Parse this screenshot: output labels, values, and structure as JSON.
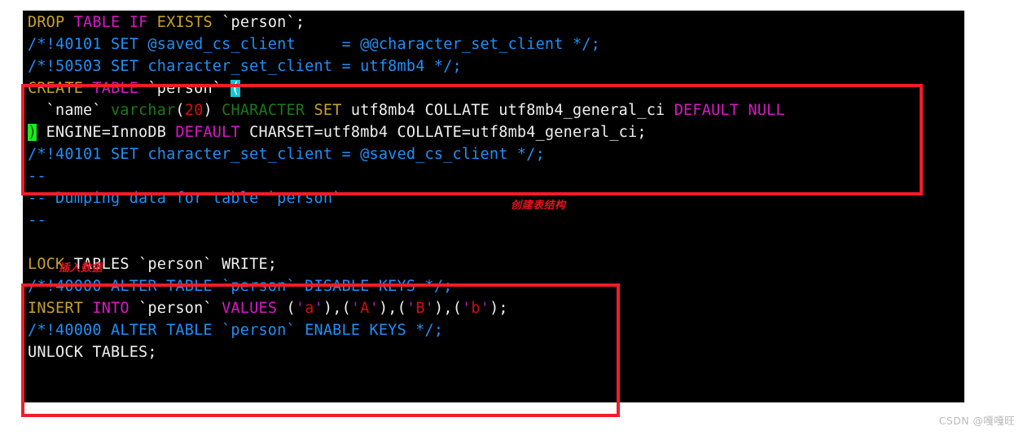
{
  "editor": {
    "background_color": "#000000",
    "default_text_color": "#e8e8e8",
    "lines": [
      {
        "id": "l1",
        "text": "DROP TABLE IF EXISTS `person`;"
      },
      {
        "id": "l2",
        "text": "/*!40101 SET @saved_cs_client     = @@character_set_client */;"
      },
      {
        "id": "l3",
        "text": "/*!50503 SET character_set_client = utf8mb4 */;"
      },
      {
        "id": "l4",
        "text": "CREATE TABLE `person` ("
      },
      {
        "id": "l5",
        "text": "  `name` varchar(20) CHARACTER SET utf8mb4 COLLATE utf8mb4_general_ci DEFAULT NULL"
      },
      {
        "id": "l6",
        "text": ") ENGINE=InnoDB DEFAULT CHARSET=utf8mb4 COLLATE=utf8mb4_general_ci;"
      },
      {
        "id": "l7",
        "text": "/*!40101 SET character_set_client = @saved_cs_client */;"
      },
      {
        "id": "l8",
        "text": "--"
      },
      {
        "id": "l9",
        "text": "-- Dumping data for table `person`"
      },
      {
        "id": "l10",
        "text": "--"
      },
      {
        "id": "l11",
        "text": ""
      },
      {
        "id": "l12",
        "text": "LOCK TABLES `person` WRITE;"
      },
      {
        "id": "l13",
        "text": "/*!40000 ALTER TABLE `person` DISABLE KEYS */;"
      },
      {
        "id": "l14",
        "text": "INSERT INTO `person` VALUES ('a'),('A'),('B'),('b');"
      },
      {
        "id": "l15",
        "text": "/*!40000 ALTER TABLE `person` ENABLE KEYS */;"
      },
      {
        "id": "l16",
        "text": "UNLOCK TABLES;"
      }
    ],
    "tokens": {
      "l1": [
        [
          "DROP",
          "kw-yellow"
        ],
        [
          " ",
          "white"
        ],
        [
          "TABLE",
          "kw-mag"
        ],
        [
          " ",
          "white"
        ],
        [
          "IF",
          "kw-mag"
        ],
        [
          " ",
          "white"
        ],
        [
          "EXISTS",
          "kw-yellow"
        ],
        [
          " `person`;",
          "white"
        ]
      ],
      "l2": [
        [
          "/*!40101 SET @saved_cs_client     = @@character_set_client */;",
          "comment"
        ]
      ],
      "l3": [
        [
          "/*!50503 SET character_set_client = utf8mb4 */;",
          "comment"
        ]
      ],
      "l4": [
        [
          "CREATE",
          "kw-yellow"
        ],
        [
          " ",
          "white"
        ],
        [
          "TABLE",
          "kw-mag"
        ],
        [
          " `person` ",
          "white"
        ],
        [
          "(",
          "hl-open"
        ]
      ],
      "l5": [
        [
          "  `name` ",
          "white"
        ],
        [
          "varchar",
          "green"
        ],
        [
          "(",
          "paren"
        ],
        [
          "20",
          "num"
        ],
        [
          ")",
          "paren"
        ],
        [
          " ",
          "white"
        ],
        [
          "CHARACTER",
          "green"
        ],
        [
          " ",
          "white"
        ],
        [
          "SET",
          "kw-yellow"
        ],
        [
          " utf8mb4 COLLATE utf8mb4_general_ci ",
          "white"
        ],
        [
          "DEFAULT",
          "kw-mag"
        ],
        [
          " ",
          "white"
        ],
        [
          "NULL",
          "kw-mag"
        ]
      ],
      "l6": [
        [
          ")",
          "hl-close"
        ],
        [
          " ENGINE=InnoDB ",
          "white"
        ],
        [
          "DEFAULT",
          "kw-mag"
        ],
        [
          " CHARSET=utf8mb4 COLLATE=utf8mb4_general_ci;",
          "white"
        ]
      ],
      "l7": [
        [
          "/*!40101 SET character_set_client = @saved_cs_client */;",
          "comment"
        ]
      ],
      "l8": [
        [
          "--",
          "comment"
        ]
      ],
      "l9": [
        [
          "-- Dumping data for table `person`",
          "comment"
        ]
      ],
      "l10": [
        [
          "--",
          "comment"
        ]
      ],
      "l11": [
        [
          "",
          "white"
        ]
      ],
      "l12": [
        [
          "LOCK",
          "kw-yellow"
        ],
        [
          " TABLES `person` WRITE;",
          "white"
        ]
      ],
      "l13": [
        [
          "/*!40000 ALTER TABLE `person` DISABLE KEYS */;",
          "comment"
        ]
      ],
      "l14": [
        [
          "INSERT",
          "kw-yellow"
        ],
        [
          " ",
          "white"
        ],
        [
          "INTO",
          "kw-mag"
        ],
        [
          " `person` ",
          "white"
        ],
        [
          "VALUES",
          "kw-mag"
        ],
        [
          " ",
          "white"
        ],
        [
          "(",
          "paren"
        ],
        [
          "'",
          "quote"
        ],
        [
          "a",
          "str"
        ],
        [
          "'",
          "quote"
        ],
        [
          ")",
          "paren"
        ],
        [
          ",",
          "white"
        ],
        [
          "(",
          "paren"
        ],
        [
          "'",
          "quote"
        ],
        [
          "A",
          "str"
        ],
        [
          "'",
          "quote"
        ],
        [
          ")",
          "paren"
        ],
        [
          ",",
          "white"
        ],
        [
          "(",
          "paren"
        ],
        [
          "'",
          "quote"
        ],
        [
          "B",
          "str"
        ],
        [
          "'",
          "quote"
        ],
        [
          ")",
          "paren"
        ],
        [
          ",",
          "white"
        ],
        [
          "(",
          "paren"
        ],
        [
          "'",
          "quote"
        ],
        [
          "b",
          "str"
        ],
        [
          "'",
          "quote"
        ],
        [
          ")",
          "paren"
        ],
        [
          ";",
          "white"
        ]
      ],
      "l15": [
        [
          "/*!40000 ALTER TABLE `person` ENABLE KEYS */;",
          "comment"
        ]
      ],
      "l16": [
        [
          "UNLOCK TABLES;",
          "white"
        ]
      ]
    }
  },
  "annotations": {
    "box_color": "#f41c28",
    "note_color": "#e8131f",
    "create_table_note": "创建表结构",
    "insert_data_note": "插入数据",
    "boxes": [
      {
        "id": "create",
        "label": "create-table-highlight-box"
      },
      {
        "id": "insert",
        "label": "insert-data-highlight-box"
      }
    ]
  },
  "watermark": {
    "text": "CSDN @嘎嘎旺"
  }
}
